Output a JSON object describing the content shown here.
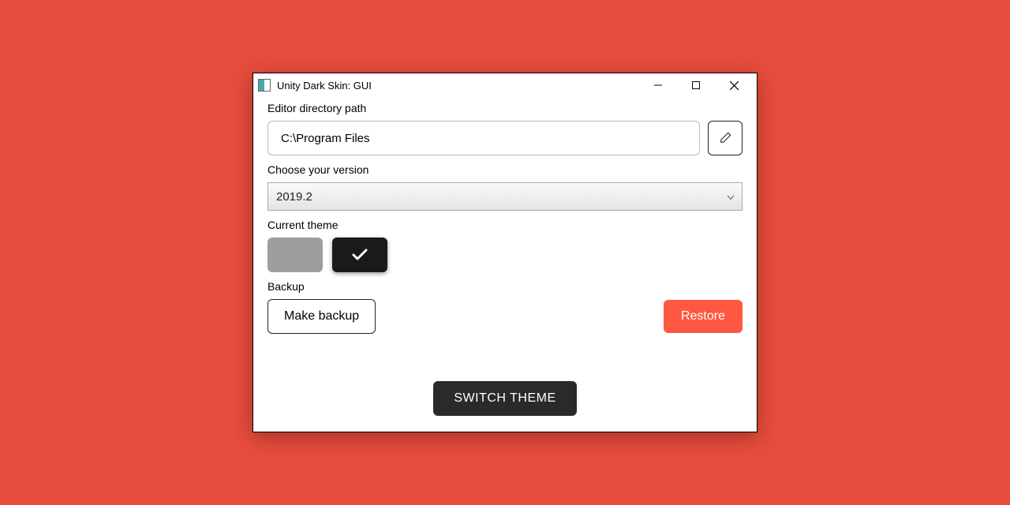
{
  "window": {
    "title": "Unity Dark Skin: GUI"
  },
  "labels": {
    "path": "Editor directory path",
    "version": "Choose your version",
    "theme": "Current theme",
    "backup": "Backup"
  },
  "path": {
    "value": "C:\\Program Files"
  },
  "version": {
    "selected": "2019.2"
  },
  "theme": {
    "selected": "dark"
  },
  "buttons": {
    "make_backup": "Make backup",
    "restore": "Restore",
    "switch_theme": "SWITCH THEME"
  },
  "colors": {
    "accent": "#ff5742",
    "background": "#e74c3c"
  }
}
